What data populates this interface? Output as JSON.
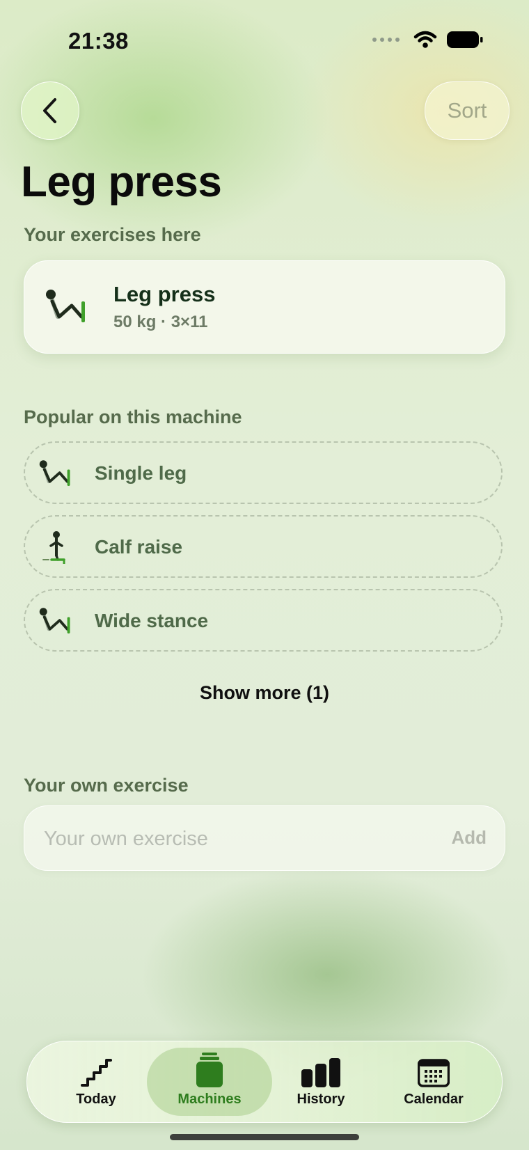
{
  "status_bar": {
    "time": "21:38"
  },
  "header": {
    "back_icon": "chevron-left-icon",
    "sort_label": "Sort"
  },
  "page": {
    "title": "Leg press"
  },
  "your_exercises": {
    "section_label": "Your exercises here",
    "items": [
      {
        "name": "Leg press",
        "meta": "50 kg · 3×11",
        "icon": "leg-press-icon"
      }
    ]
  },
  "popular": {
    "section_label": "Popular on this machine",
    "items": [
      {
        "label": "Single leg",
        "icon": "leg-press-icon"
      },
      {
        "label": "Calf raise",
        "icon": "calf-raise-icon"
      },
      {
        "label": "Wide stance",
        "icon": "leg-press-icon"
      }
    ],
    "show_more_label": "Show more (1)"
  },
  "own_exercise": {
    "section_label": "Your own exercise",
    "placeholder": "Your own exercise",
    "value": "",
    "add_label": "Add"
  },
  "tab_bar": {
    "active": "Machines",
    "active_color": "#2e7d1e",
    "tabs": [
      {
        "label": "Today",
        "icon": "stairs-icon"
      },
      {
        "label": "Machines",
        "icon": "machine-weight-icon"
      },
      {
        "label": "History",
        "icon": "bar-chart-icon"
      },
      {
        "label": "Calendar",
        "icon": "calendar-icon"
      }
    ]
  },
  "colors": {
    "accent_green": "#2e7d1e",
    "section_text": "#566b4c",
    "leg_press_green": "#3fa02a"
  }
}
